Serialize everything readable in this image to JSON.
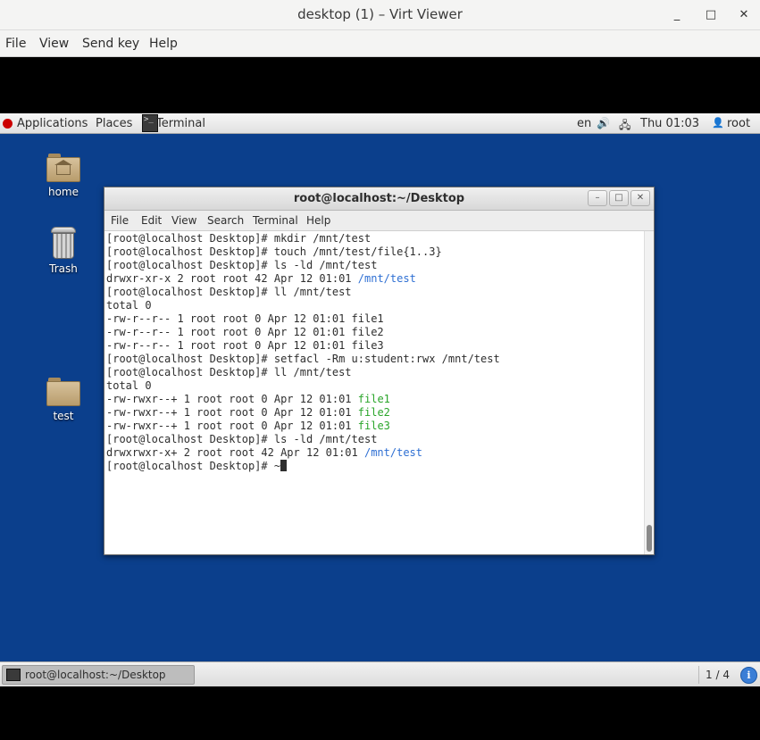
{
  "viewer": {
    "title": "desktop (1) – Virt Viewer",
    "menu": [
      "File",
      "View",
      "Send key",
      "Help"
    ],
    "controls": {
      "minimize": "_",
      "maximize": "□",
      "close": "✕"
    }
  },
  "topbar": {
    "applications": "Applications",
    "places": "Places",
    "terminal": "Terminal",
    "lang": "en",
    "clock": "Thu 01:03",
    "user": "root",
    "icons": [
      "volume-icon",
      "network-icon",
      "user-icon"
    ]
  },
  "desktop_icons": [
    {
      "label": "home",
      "icon": "home-folder-icon"
    },
    {
      "label": "Trash",
      "icon": "trash-icon"
    },
    {
      "label": "test",
      "icon": "folder-icon"
    }
  ],
  "terminal": {
    "title": "root@localhost:~/Desktop",
    "menu": [
      "File",
      "Edit",
      "View",
      "Search",
      "Terminal",
      "Help"
    ],
    "lines": [
      [
        {
          "t": "[root@localhost Desktop]# mkdir /mnt/test"
        }
      ],
      [
        {
          "t": "[root@localhost Desktop]# touch /mnt/test/file{1..3}"
        }
      ],
      [
        {
          "t": "[root@localhost Desktop]# ls -ld /mnt/test"
        }
      ],
      [
        {
          "t": "drwxr-xr-x 2 root root 42 Apr 12 01:01 "
        },
        {
          "t": "/mnt/test",
          "c": "blue"
        }
      ],
      [
        {
          "t": "[root@localhost Desktop]# ll /mnt/test"
        }
      ],
      [
        {
          "t": "total 0"
        }
      ],
      [
        {
          "t": "-rw-r--r-- 1 root root 0 Apr 12 01:01 file1"
        }
      ],
      [
        {
          "t": "-rw-r--r-- 1 root root 0 Apr 12 01:01 file2"
        }
      ],
      [
        {
          "t": "-rw-r--r-- 1 root root 0 Apr 12 01:01 file3"
        }
      ],
      [
        {
          "t": "[root@localhost Desktop]# setfacl -Rm u:student:rwx /mnt/test"
        }
      ],
      [
        {
          "t": "[root@localhost Desktop]# ll /mnt/test"
        }
      ],
      [
        {
          "t": "total 0"
        }
      ],
      [
        {
          "t": "-rw-rwxr--+ 1 root root 0 Apr 12 01:01 "
        },
        {
          "t": "file1",
          "c": "green"
        }
      ],
      [
        {
          "t": "-rw-rwxr--+ 1 root root 0 Apr 12 01:01 "
        },
        {
          "t": "file2",
          "c": "green"
        }
      ],
      [
        {
          "t": "-rw-rwxr--+ 1 root root 0 Apr 12 01:01 "
        },
        {
          "t": "file3",
          "c": "green"
        }
      ],
      [
        {
          "t": "[root@localhost Desktop]# ls -ld /mnt/test"
        }
      ],
      [
        {
          "t": "drwxrwxr-x+ 2 root root 42 Apr 12 01:01 "
        },
        {
          "t": "/mnt/test",
          "c": "blue"
        }
      ],
      [
        {
          "t": "[root@localhost Desktop]# ~"
        },
        {
          "cursor": true
        }
      ]
    ]
  },
  "taskbar": {
    "task_label": "root@localhost:~/Desktop",
    "pager": "1 / 4",
    "notify": "i"
  },
  "colors": {
    "desktop": "#0b3f8c",
    "ls_dir": "#2e6fd3",
    "ls_exec": "#2aa52a"
  }
}
